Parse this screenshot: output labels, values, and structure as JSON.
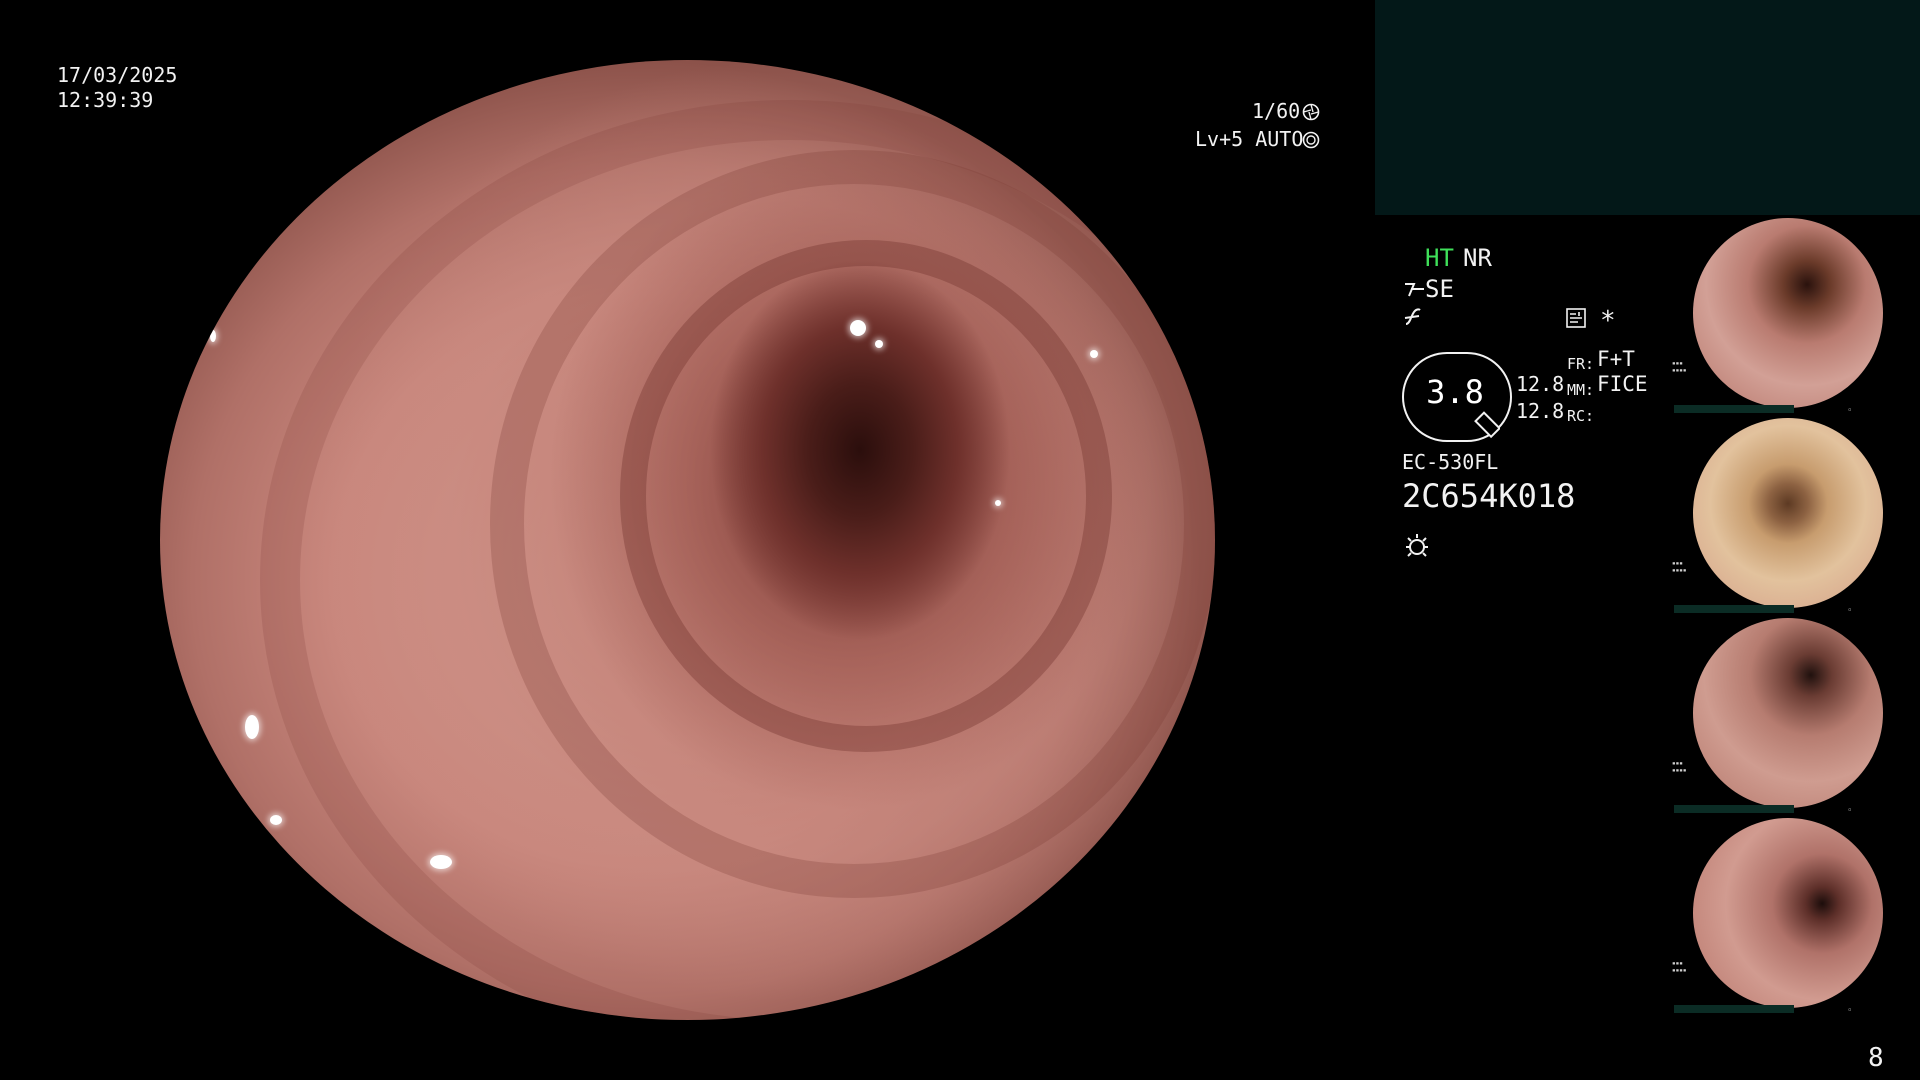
{
  "datetime": {
    "date": "17/03/2025",
    "time": "12:39:39"
  },
  "exposure": {
    "shutter": "1/60",
    "shutter_icon": "aperture-icon",
    "level": "Lv+5 AUTO",
    "level_icon": "iris-icon"
  },
  "settings": {
    "ht": "HT",
    "nr": "NR",
    "se": "SE",
    "se_icon": "structure-enhance-icon",
    "gamma_icon": "gamma-icon",
    "zoom": "3.8",
    "zoom_icon": "magnifier-icon",
    "values": [
      "12.8",
      "12.8"
    ],
    "fr_label": "FR:",
    "fr_value": "F+T",
    "mm_label": "MM:",
    "mm_value": "FICE",
    "rc_label": "RC:",
    "freeze_icon": "freeze-icon",
    "asterisk": "*"
  },
  "scope": {
    "model": "EC-530FL",
    "serial": "2C654K018",
    "light_icon": "light-source-icon"
  },
  "colors": {
    "panel": "#031818",
    "highlight": "#3fe05a"
  },
  "thumbnails": [
    {
      "name": "thumbnail-1"
    },
    {
      "name": "thumbnail-2"
    },
    {
      "name": "thumbnail-3"
    },
    {
      "name": "thumbnail-4"
    }
  ],
  "page_number": "8"
}
